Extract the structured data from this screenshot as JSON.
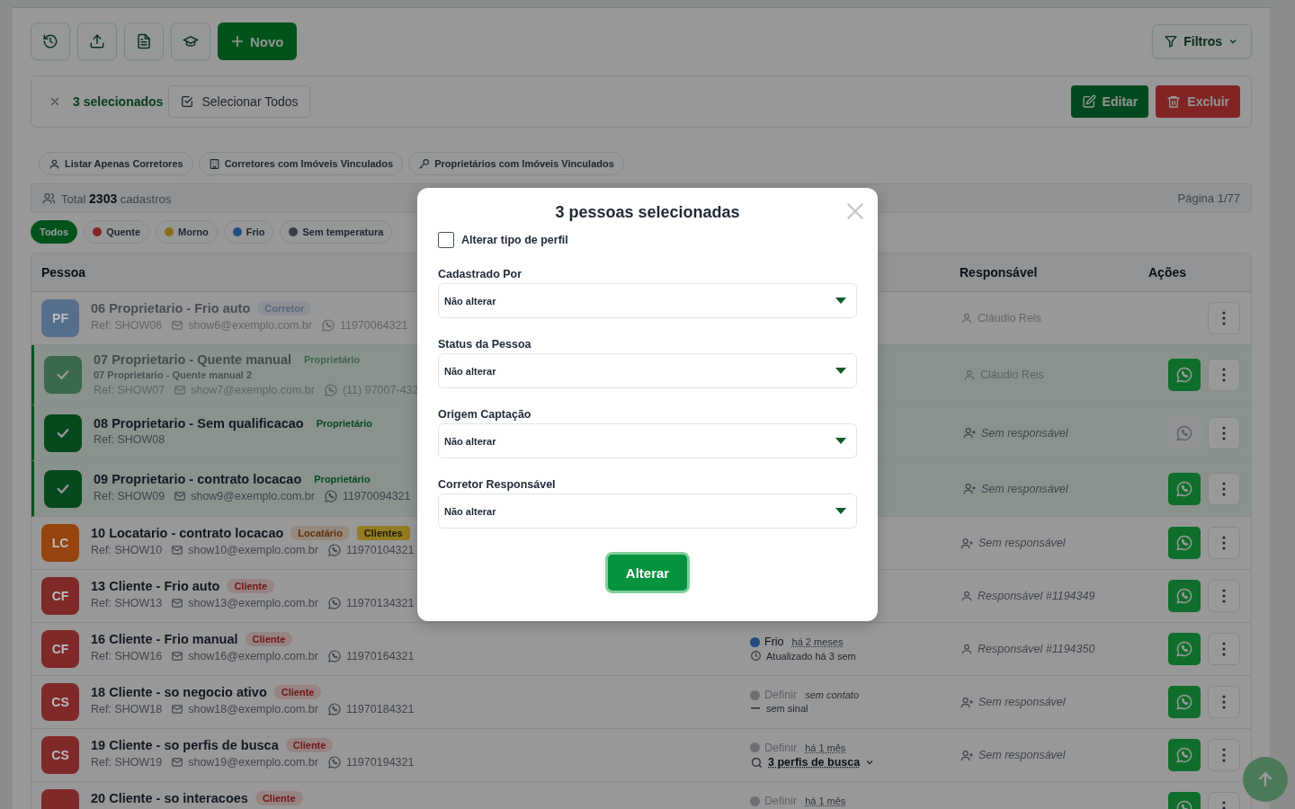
{
  "toolbar": {
    "new_button": "Novo",
    "filters_button": "Filtros"
  },
  "selection": {
    "count": "3 selecionados",
    "select_all": "Selecionar Todos",
    "edit": "Editar",
    "delete": "Excluir"
  },
  "quick_filters": [
    {
      "label": "Listar Apenas Corretores",
      "kind": "person"
    },
    {
      "label": "Corretores com Imóveis Vinculados",
      "kind": "building"
    },
    {
      "label": "Proprietários com Imóveis Vinculados",
      "kind": "key"
    }
  ],
  "summary": {
    "total": "Total **2303** cadastros",
    "page": "Página 1/77"
  },
  "temperature_filters": [
    {
      "label": "Todos",
      "selected": true
    },
    {
      "label": "Quente",
      "selected": false,
      "color": "#862424"
    },
    {
      "label": "Morno",
      "selected": false,
      "color": "#896d14"
    },
    {
      "label": "Frio",
      "selected": false,
      "color": "#234c80"
    },
    {
      "label": "Sem temperatura",
      "selected": false,
      "color": "#393d43"
    }
  ],
  "table": {
    "columns": [
      "Pessoa",
      "Responsável",
      "Ações"
    ],
    "rows": [
      {
        "initials": "PF",
        "color": "#556e8b",
        "name": "06 Proprietario - Frio auto",
        "tags": [
          {
            "label": "Corretor",
            "kind": "corretor"
          }
        ],
        "ref": "Ref: SHOW06",
        "email": "show6@exemplo.com.br",
        "phone": "11970064321",
        "selected": false,
        "inactive": true,
        "responsible": {
          "label": "Cláudio Reis",
          "kind": "named"
        },
        "chat": false
      },
      {
        "name": "07 Proprietario - Quente manual",
        "subname": "07 Proprietario - Quente manual 2",
        "tags": [
          {
            "label": "Proprietário",
            "kind": "proprietario"
          }
        ],
        "ref": "Ref: SHOW07",
        "email": "show7@exemplo.com.br",
        "phone": "(11) 97007-432",
        "selected": true,
        "inactive": true,
        "responsible": {
          "label": "Cláudio Reis",
          "kind": "named"
        },
        "chat": true,
        "chat_disabled": false
      },
      {
        "name": "08 Proprietario - Sem qualificacao",
        "tags": [
          {
            "label": "Proprietário",
            "kind": "proprietario"
          }
        ],
        "ref": "Ref: SHOW08",
        "selected": true,
        "inactive": false,
        "responsible": {
          "label": "Sem responsável",
          "kind": "none"
        },
        "chat": true,
        "chat_disabled": true
      },
      {
        "name": "09 Proprietario - contrato locacao",
        "tags": [
          {
            "label": "Proprietário",
            "kind": "proprietario"
          }
        ],
        "ref": "Ref: SHOW09",
        "email": "show9@exemplo.com.br",
        "phone": "11970094321",
        "selected": true,
        "inactive": false,
        "responsible": {
          "label": "Sem responsável",
          "kind": "none"
        },
        "chat": true,
        "chat_disabled": false
      },
      {
        "initials": "LC",
        "color": "#95450d",
        "name": "10 Locatario - contrato locacao",
        "tags": [
          {
            "label": "Locatário",
            "kind": "locatario"
          },
          {
            "label": "Clientes",
            "kind": "clientes"
          }
        ],
        "ref": "Ref: SHOW10",
        "email": "show10@exemplo.com.br",
        "phone": "11970104321",
        "selected": false,
        "inactive": false,
        "responsible": {
          "label": "Sem responsável",
          "kind": "none"
        },
        "chat": true,
        "chat_disabled": false
      },
      {
        "initials": "CF",
        "color": "#802929",
        "name": "13 Cliente - Frio auto",
        "tags": [
          {
            "label": "Cliente",
            "kind": "cliente"
          }
        ],
        "ref": "Ref: SHOW13",
        "email": "show13@exemplo.com.br",
        "phone": "11970134321",
        "selected": false,
        "inactive": false,
        "responsible": {
          "label": "Responsável #1194349",
          "kind": "generic"
        },
        "chat": true,
        "chat_disabled": false
      },
      {
        "initials": "CF",
        "color": "#802929",
        "name": "16 Cliente - Frio manual",
        "tags": [
          {
            "label": "Cliente",
            "kind": "cliente"
          }
        ],
        "ref": "Ref: SHOW16",
        "email": "show16@exemplo.com.br",
        "phone": "11970164321",
        "selected": false,
        "inactive": false,
        "status": {
          "label": "Frio",
          "set": true,
          "color": "#234c80",
          "note": {
            "text": "há 2 meses",
            "kind": "time"
          },
          "detail": {
            "text": "Atualizado há 3 sem",
            "kind": "updated"
          }
        },
        "responsible": {
          "label": "Responsável #1194350",
          "kind": "generic"
        },
        "chat": true,
        "chat_disabled": false
      },
      {
        "initials": "CS",
        "color": "#802929",
        "name": "18 Cliente - so negocio ativo",
        "tags": [
          {
            "label": "Cliente",
            "kind": "cliente"
          }
        ],
        "ref": "Ref: SHOW18",
        "email": "show18@exemplo.com.br",
        "phone": "11970184321",
        "selected": false,
        "inactive": false,
        "status": {
          "label": "Definir",
          "set": false,
          "color": "#6c6e71",
          "note": {
            "text": "sem contato",
            "kind": "empty"
          },
          "detail": {
            "text": "sem sinal",
            "kind": "signal"
          }
        },
        "responsible": {
          "label": "Sem responsável",
          "kind": "none"
        },
        "chat": true,
        "chat_disabled": false
      },
      {
        "initials": "CS",
        "color": "#802929",
        "name": "19 Cliente - so perfis de busca",
        "tags": [
          {
            "label": "Cliente",
            "kind": "cliente"
          }
        ],
        "ref": "Ref: SHOW19",
        "email": "show19@exemplo.com.br",
        "phone": "11970194321",
        "selected": false,
        "inactive": false,
        "status": {
          "label": "Definir",
          "set": false,
          "color": "#6c6e71",
          "note": {
            "text": "há 1 mês",
            "kind": "time"
          },
          "detail": {
            "text": "3 perfis de busca",
            "kind": "search"
          }
        },
        "responsible": {
          "label": "Sem responsável",
          "kind": "none"
        },
        "chat": true,
        "chat_disabled": false
      },
      {
        "color": "#802929",
        "name": "20 Cliente - so interacoes",
        "tags": [
          {
            "label": "Cliente",
            "kind": "cliente"
          }
        ],
        "selected": false,
        "inactive": false,
        "status": {
          "label": "Definir",
          "set": false,
          "color": "#6c6e71",
          "note": {
            "text": "há 1 mês",
            "kind": "time"
          }
        },
        "chat": true,
        "chat_disabled": false
      }
    ]
  },
  "modal": {
    "title": "3 pessoas selecionadas",
    "profile_checkbox": {
      "label": "Alterar tipo de perfil",
      "checked": false
    },
    "fields": [
      {
        "label": "Cadastrado Por",
        "value": "Não alterar"
      },
      {
        "label": "Status da Pessoa",
        "value": "Não alterar"
      },
      {
        "label": "Origem Captação",
        "value": "Não alterar"
      },
      {
        "label": "Corretor Responsável",
        "value": "Não alterar"
      }
    ],
    "submit": "Alterar"
  }
}
